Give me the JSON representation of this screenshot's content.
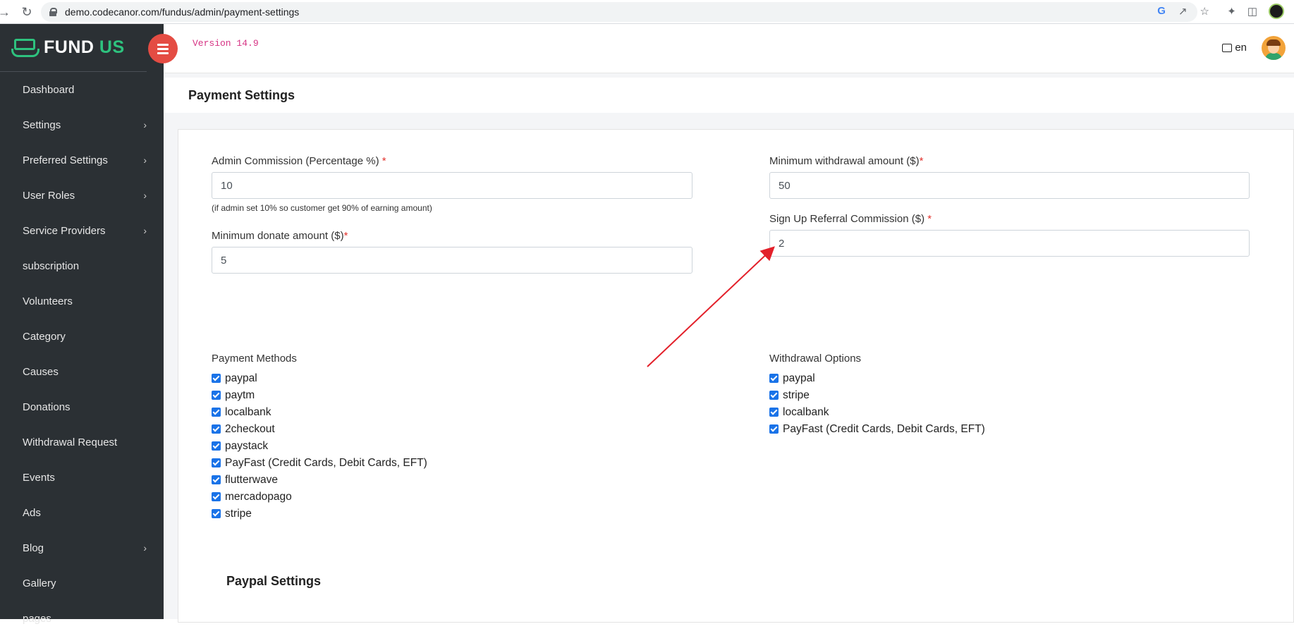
{
  "browser": {
    "url": "demo.codecanor.com/fundus/admin/payment-settings"
  },
  "brand": {
    "part1": "FUND",
    "part2": "US",
    "accent": "#2ec27e"
  },
  "sidebar": {
    "items": [
      {
        "label": "Dashboard",
        "chevron": false
      },
      {
        "label": "Settings",
        "chevron": true
      },
      {
        "label": "Preferred Settings",
        "chevron": true
      },
      {
        "label": "User Roles",
        "chevron": true
      },
      {
        "label": "Service Providers",
        "chevron": true
      },
      {
        "label": "subscription",
        "chevron": false
      },
      {
        "label": "Volunteers",
        "chevron": false
      },
      {
        "label": "Category",
        "chevron": false
      },
      {
        "label": "Causes",
        "chevron": false
      },
      {
        "label": "Donations",
        "chevron": false
      },
      {
        "label": "Withdrawal Request",
        "chevron": false
      },
      {
        "label": "Events",
        "chevron": false
      },
      {
        "label": "Ads",
        "chevron": false
      },
      {
        "label": "Blog",
        "chevron": true
      },
      {
        "label": "Gallery",
        "chevron": false
      },
      {
        "label": "pages",
        "chevron": false
      }
    ]
  },
  "header": {
    "version": "Version 14.9",
    "language": "en",
    "toggle_color": "#e44c43"
  },
  "page": {
    "title": "Payment Settings"
  },
  "form": {
    "admin_commission": {
      "label": "Admin Commission (Percentage %)",
      "required": "*",
      "value": "10",
      "hint": "(if admin set 10% so customer get 90% of earning amount)"
    },
    "min_donate": {
      "label": "Minimum donate amount ($)",
      "required": "*",
      "value": "5"
    },
    "min_withdrawal": {
      "label": "Minimum withdrawal amount ($)",
      "required": "*",
      "value": "50"
    },
    "signup_referral": {
      "label": "Sign Up Referral Commission ($)",
      "required": "*",
      "value": "2"
    }
  },
  "payment_methods": {
    "title": "Payment Methods",
    "items": [
      {
        "label": "paypal",
        "checked": true
      },
      {
        "label": "paytm",
        "checked": true
      },
      {
        "label": "localbank",
        "checked": true
      },
      {
        "label": "2checkout",
        "checked": true
      },
      {
        "label": "paystack",
        "checked": true
      },
      {
        "label": "PayFast (Credit Cards, Debit Cards, EFT)",
        "checked": true
      },
      {
        "label": "flutterwave",
        "checked": true
      },
      {
        "label": "mercadopago",
        "checked": true
      },
      {
        "label": "stripe",
        "checked": true
      }
    ]
  },
  "withdrawal_options": {
    "title": "Withdrawal Options",
    "items": [
      {
        "label": "paypal",
        "checked": true
      },
      {
        "label": "stripe",
        "checked": true
      },
      {
        "label": "localbank",
        "checked": true
      },
      {
        "label": "PayFast (Credit Cards, Debit Cards, EFT)",
        "checked": true
      }
    ]
  },
  "paypal_section": {
    "title": "Paypal Settings"
  },
  "annotation": {
    "arrow_color": "#e3202a"
  }
}
